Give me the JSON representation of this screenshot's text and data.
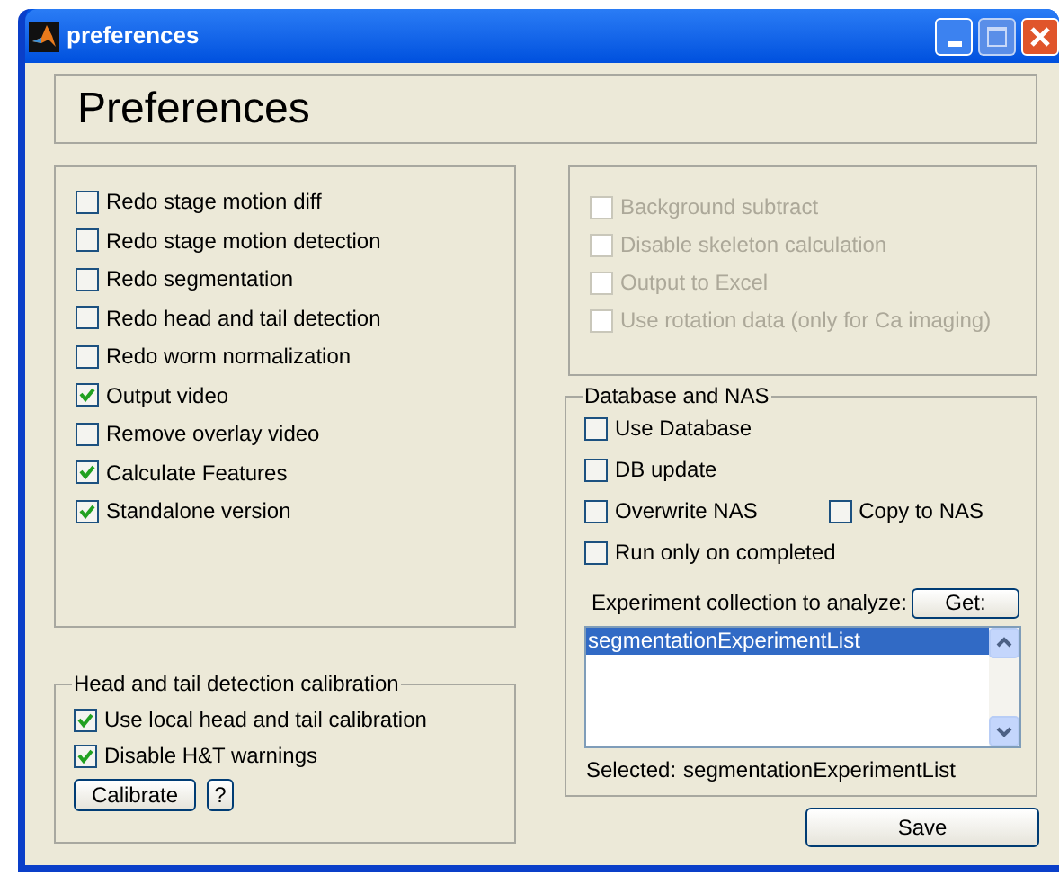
{
  "window": {
    "title": "preferences"
  },
  "header": {
    "title": "Preferences"
  },
  "options": [
    {
      "label": "Redo stage motion diff",
      "checked": false
    },
    {
      "label": "Redo stage motion detection",
      "checked": false
    },
    {
      "label": "Redo segmentation",
      "checked": false
    },
    {
      "label": "Redo head and tail detection",
      "checked": false
    },
    {
      "label": "Redo worm normalization",
      "checked": false
    },
    {
      "label": "Output video",
      "checked": true
    },
    {
      "label": "Remove overlay video",
      "checked": false
    },
    {
      "label": "Calculate Features",
      "checked": true
    },
    {
      "label": "Standalone version",
      "checked": true
    }
  ],
  "advanced_options": [
    {
      "label": "Background subtract",
      "checked": false,
      "disabled": true
    },
    {
      "label": "Disable skeleton calculation",
      "checked": false,
      "disabled": true
    },
    {
      "label": "Output to Excel",
      "checked": false,
      "disabled": true
    },
    {
      "label": "Use rotation data (only for Ca imaging)",
      "checked": false,
      "disabled": true
    }
  ],
  "calibration": {
    "title": "Head and tail detection calibration",
    "options": [
      {
        "label": "Use local head and tail calibration",
        "checked": true
      },
      {
        "label": "Disable H&T warnings",
        "checked": true
      }
    ],
    "buttons": [
      "Calibrate",
      "?"
    ]
  },
  "database": {
    "title": "Database and NAS",
    "rows": [
      {
        "items": [
          {
            "label": "Use Database",
            "checked": false
          }
        ]
      },
      {
        "items": [
          {
            "label": "DB update",
            "checked": false
          }
        ]
      },
      {
        "items": [
          {
            "label": "Overwrite NAS",
            "checked": false
          },
          {
            "label": "Copy to NAS",
            "checked": false
          }
        ]
      },
      {
        "items": [
          {
            "label": "Run only on completed",
            "checked": false
          }
        ]
      }
    ],
    "collection_label": "Experiment collection to analyze:",
    "get_button": "Get:",
    "collections": [
      {
        "label": "segmentationExperimentList",
        "selected": true
      }
    ],
    "selected_label": "Selected:",
    "selected_value": "segmentationExperimentList"
  },
  "save_button": "Save"
}
